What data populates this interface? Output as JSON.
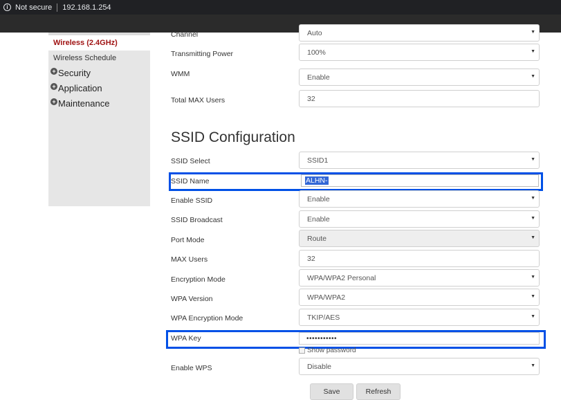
{
  "browser": {
    "security_label": "Not secure",
    "url": "192.168.1.254"
  },
  "sidebar": {
    "items": [
      {
        "label": "Wireless (2.4GHz)",
        "active": true
      },
      {
        "label": "Wireless Schedule",
        "active": false
      }
    ],
    "groups": [
      {
        "label": "Security",
        "icon": "plus-circle-icon"
      },
      {
        "label": "Application",
        "icon": "plus-circle-icon"
      },
      {
        "label": "Maintenance",
        "icon": "plus-circle-icon"
      }
    ]
  },
  "radio": {
    "channel": {
      "label": "Channel",
      "value": "Auto"
    },
    "tx_power": {
      "label": "Transmitting Power",
      "value": "100%"
    },
    "wmm": {
      "label": "WMM",
      "value": "Enable"
    },
    "total_max_users": {
      "label": "Total MAX Users",
      "value": "32"
    }
  },
  "ssid": {
    "title": "SSID Configuration",
    "select": {
      "label": "SSID Select",
      "value": "SSID1"
    },
    "name": {
      "label": "SSID Name",
      "value": "ALHN-"
    },
    "enable": {
      "label": "Enable SSID",
      "value": "Enable"
    },
    "broadcast": {
      "label": "SSID Broadcast",
      "value": "Enable"
    },
    "port_mode": {
      "label": "Port Mode",
      "value": "Route"
    },
    "max_users": {
      "label": "MAX Users",
      "value": "32"
    },
    "encryption_mode": {
      "label": "Encryption Mode",
      "value": "WPA/WPA2 Personal"
    },
    "wpa_version": {
      "label": "WPA Version",
      "value": "WPA/WPA2"
    },
    "wpa_encryption_mode": {
      "label": "WPA Encryption Mode",
      "value": "TKIP/AES"
    },
    "wpa_key": {
      "label": "WPA Key",
      "value": "•••••••••••"
    },
    "show_password": "Show password",
    "wps": {
      "label": "Enable WPS",
      "value": "Disable"
    }
  },
  "buttons": {
    "save": "Save",
    "refresh": "Refresh"
  },
  "colors": {
    "highlight": "#0050e6",
    "active_nav": "#a01414",
    "sidebar_bg": "#e6e6e6"
  }
}
